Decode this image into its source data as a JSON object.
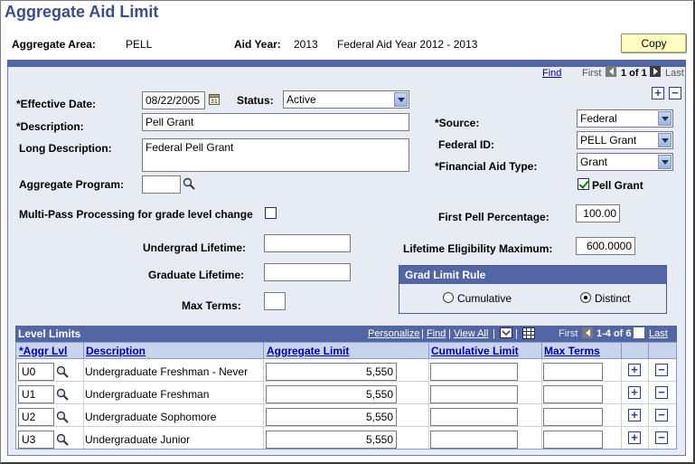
{
  "page": {
    "title": "Aggregate Aid Limit"
  },
  "header": {
    "aggregate_area_label": "Aggregate Area:",
    "aggregate_area_value": "PELL",
    "aid_year_label": "Aid Year:",
    "aid_year_value": "2013",
    "aid_year_desc": "Federal Aid Year 2012 - 2013",
    "copy_label": "Copy"
  },
  "nav": {
    "find": "Find",
    "first": "First",
    "count": "1 of 1",
    "last": "Last"
  },
  "form": {
    "effective_date_label": "*Effective Date:",
    "effective_date_value": "08/22/2005",
    "status_label": "Status:",
    "status_value": "Active",
    "description_label": "*Description:",
    "description_value": "Pell Grant",
    "long_description_label": "Long Description:",
    "long_description_value": "Federal Pell Grant",
    "aggregate_program_label": "Aggregate Program:",
    "aggregate_program_value": "",
    "source_label": "*Source:",
    "source_value": "Federal",
    "federal_id_label": "Federal ID:",
    "federal_id_value": "PELL Grant",
    "financial_aid_type_label": "*Financial Aid Type:",
    "financial_aid_type_value": "Grant",
    "pell_grant_label": "Pell Grant",
    "pell_grant_checked": true,
    "multipass_label": "Multi-Pass Processing for grade level change",
    "multipass_checked": false,
    "first_pell_pct_label": "First Pell Percentage:",
    "first_pell_pct_value": "100.00",
    "undergrad_lifetime_label": "Undergrad Lifetime:",
    "graduate_lifetime_label": "Graduate Lifetime:",
    "max_terms_label": "Max Terms:",
    "lifetime_elig_label": "Lifetime Eligibility Maximum:",
    "lifetime_elig_value": "600.0000",
    "grad_limit_rule": {
      "title": "Grad Limit Rule",
      "options": [
        "Cumulative",
        "Distinct"
      ],
      "selected": "Distinct"
    }
  },
  "level_limits": {
    "title": "Level Limits",
    "tools": {
      "personalize": "Personalize",
      "find": "Find",
      "view_all": "View All"
    },
    "nav": {
      "first": "First",
      "count": "1-4 of 6",
      "last": "Last"
    },
    "columns": [
      "*Aggr Lvl",
      "Description",
      "Aggregate Limit",
      "Cumulative Limit",
      "Max Terms"
    ],
    "rows": [
      {
        "lvl": "U0",
        "description": "Undergraduate Freshman - Never",
        "limit": "5,550",
        "cumulative": "",
        "max_terms": ""
      },
      {
        "lvl": "U1",
        "description": "Undergraduate Freshman",
        "limit": "5,550",
        "cumulative": "",
        "max_terms": ""
      },
      {
        "lvl": "U2",
        "description": "Undergraduate Sophomore",
        "limit": "5,550",
        "cumulative": "",
        "max_terms": ""
      },
      {
        "lvl": "U3",
        "description": "Undergraduate Junior",
        "limit": "5,550",
        "cumulative": "",
        "max_terms": ""
      }
    ]
  },
  "icons": [
    "calendar-icon",
    "search-icon",
    "plus-icon",
    "minus-icon",
    "prev-icon",
    "next-icon",
    "chevron-down-icon",
    "grid-icon",
    "download-icon"
  ],
  "colors": {
    "title": "#3d4d8a",
    "header_bar": "#5266a6",
    "panel_bg": "#e6ebf4",
    "copy_bg": "#ffffc0",
    "link": "#0000aa"
  }
}
